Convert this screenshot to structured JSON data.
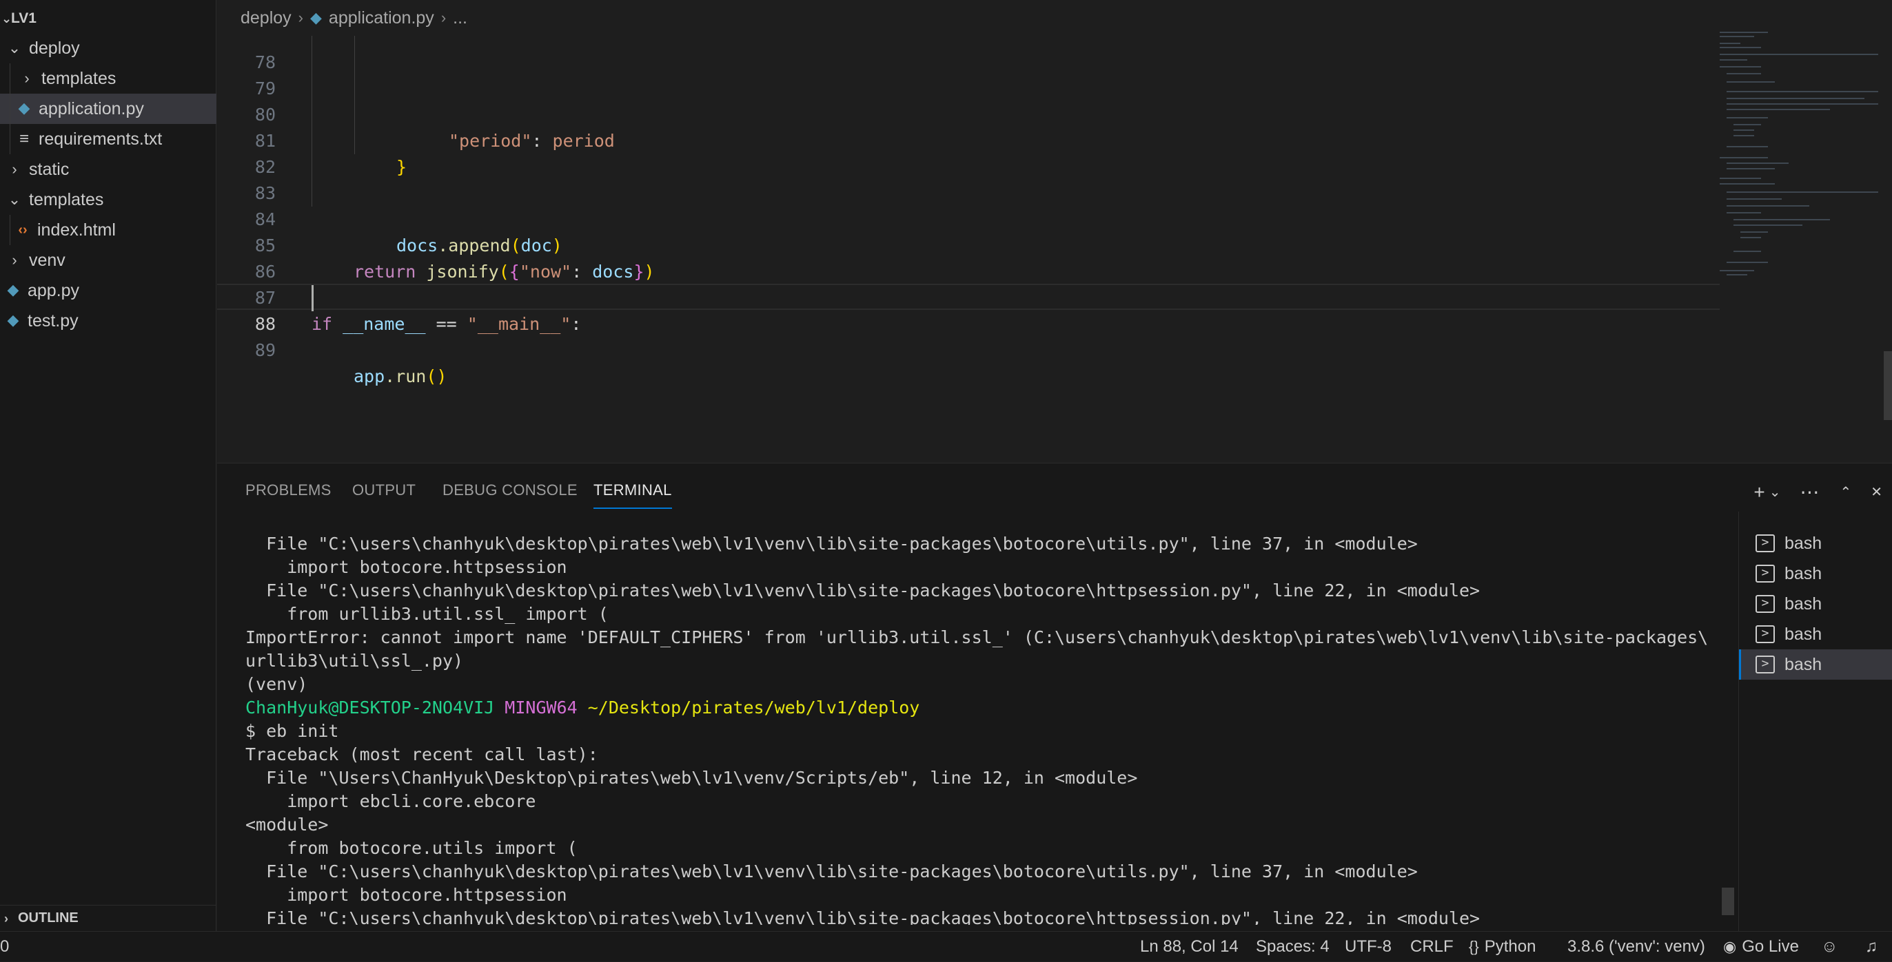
{
  "explorer": {
    "root": "LV1",
    "items": [
      {
        "label": "deploy",
        "kind": "folder",
        "expanded": true
      },
      {
        "label": "templates",
        "kind": "folder",
        "expanded": false
      },
      {
        "label": "application.py",
        "kind": "python",
        "selected": true
      },
      {
        "label": "requirements.txt",
        "kind": "text"
      },
      {
        "label": "static",
        "kind": "folder",
        "expanded": false
      },
      {
        "label": "templates",
        "kind": "folder",
        "expanded": true
      },
      {
        "label": "index.html",
        "kind": "html"
      },
      {
        "label": "venv",
        "kind": "folder",
        "expanded": false
      },
      {
        "label": "app.py",
        "kind": "python"
      },
      {
        "label": "test.py",
        "kind": "python"
      }
    ],
    "outline": "OUTLINE"
  },
  "breadcrumb": {
    "folder": "deploy",
    "file": "application.py",
    "more": "..."
  },
  "editor": {
    "line_numbers": [
      "78",
      "79",
      "80",
      "81",
      "82",
      "83",
      "84",
      "85",
      "86",
      "87",
      "88",
      "89"
    ],
    "tokens": {
      "l78_key": "\"period\"",
      "l78_colon": ": ",
      "l78_val": "period",
      "l79_brace": "}",
      "l82_obj": "docs",
      "l82_fn": ".append",
      "l82_open": "(",
      "l82_arg": "doc",
      "l82_close": ")",
      "l84_kw": "return ",
      "l84_fn": "jsonify",
      "l84_p1": "(",
      "l84_b1": "{",
      "l84_str": "\"now\"",
      "l84_colon": ": ",
      "l84_var": "docs",
      "l84_b2": "}",
      "l84_p2": ")",
      "l87_kw": "if ",
      "l87_var": "__name__",
      "l87_op": " == ",
      "l87_str": "\"__main__\"",
      "l87_colon": ":",
      "l88_obj": "app",
      "l88_fn": ".run",
      "l88_paren": "()"
    }
  },
  "panel": {
    "tabs": [
      "PROBLEMS",
      "OUTPUT",
      "DEBUG CONSOLE",
      "TERMINAL"
    ],
    "active_tab": "TERMINAL",
    "terminals": [
      "bash",
      "bash",
      "bash",
      "bash",
      "bash"
    ]
  },
  "terminal": {
    "lines": [
      "  File \"C:\\users\\chanhyuk\\desktop\\pirates\\web\\lv1\\venv\\lib\\site-packages\\botocore\\utils.py\", line 37, in <module>",
      "    import botocore.httpsession",
      "  File \"C:\\users\\chanhyuk\\desktop\\pirates\\web\\lv1\\venv\\lib\\site-packages\\botocore\\httpsession.py\", line 22, in <module>",
      "    from urllib3.util.ssl_ import (",
      "ImportError: cannot import name 'DEFAULT_CIPHERS' from 'urllib3.util.ssl_' (C:\\users\\chanhyuk\\desktop\\pirates\\web\\lv1\\venv\\lib\\site-packages\\",
      "urllib3\\util\\ssl_.py)",
      "(venv)"
    ],
    "prompt_user": "ChanHyuk@DESKTOP-2NO4VIJ",
    "prompt_env": "MINGW64",
    "prompt_path": "~/Desktop/pirates/web/lv1/deploy",
    "command": "$ eb init",
    "lines_after": [
      "Traceback (most recent call last):",
      "  File \"\\Users\\ChanHyuk\\Desktop\\pirates\\web\\lv1\\venv/Scripts/eb\", line 12, in <module>",
      "    import ebcli.core.ebcore",
      "<module>",
      "    from botocore.utils import (",
      "  File \"C:\\users\\chanhyuk\\desktop\\pirates\\web\\lv1\\venv\\lib\\site-packages\\botocore\\utils.py\", line 37, in <module>",
      "    import botocore.httpsession",
      "  File \"C:\\users\\chanhyuk\\desktop\\pirates\\web\\lv1\\venv\\lib\\site-packages\\botocore\\httpsession.py\", line 22, in <module>"
    ]
  },
  "statusbar": {
    "left": "0",
    "position": "Ln 88, Col 14",
    "spaces": "Spaces: 4",
    "encoding": "UTF-8",
    "eol": "CRLF",
    "language": "Python",
    "interpreter": "3.8.6 ('venv': venv)",
    "golive": "Go Live"
  },
  "icons": {
    "chevron_down": "chevron-down-icon",
    "chevron_right": "chevron-right-icon",
    "python": "python-file-icon",
    "text": "text-file-icon",
    "html": "html-file-icon",
    "terminal": "terminal-icon",
    "plus": "plus-icon",
    "ellipsis": "ellipsis-icon",
    "maximize": "chevron-up-icon",
    "close": "close-icon",
    "broadcast": "broadcast-icon",
    "feedback": "feedback-icon",
    "bell": "bell-icon"
  },
  "colors": {
    "accent": "#0078d4",
    "prompt_user": "#23d18b",
    "prompt_env": "#d670d6",
    "prompt_path": "#e5e510"
  }
}
